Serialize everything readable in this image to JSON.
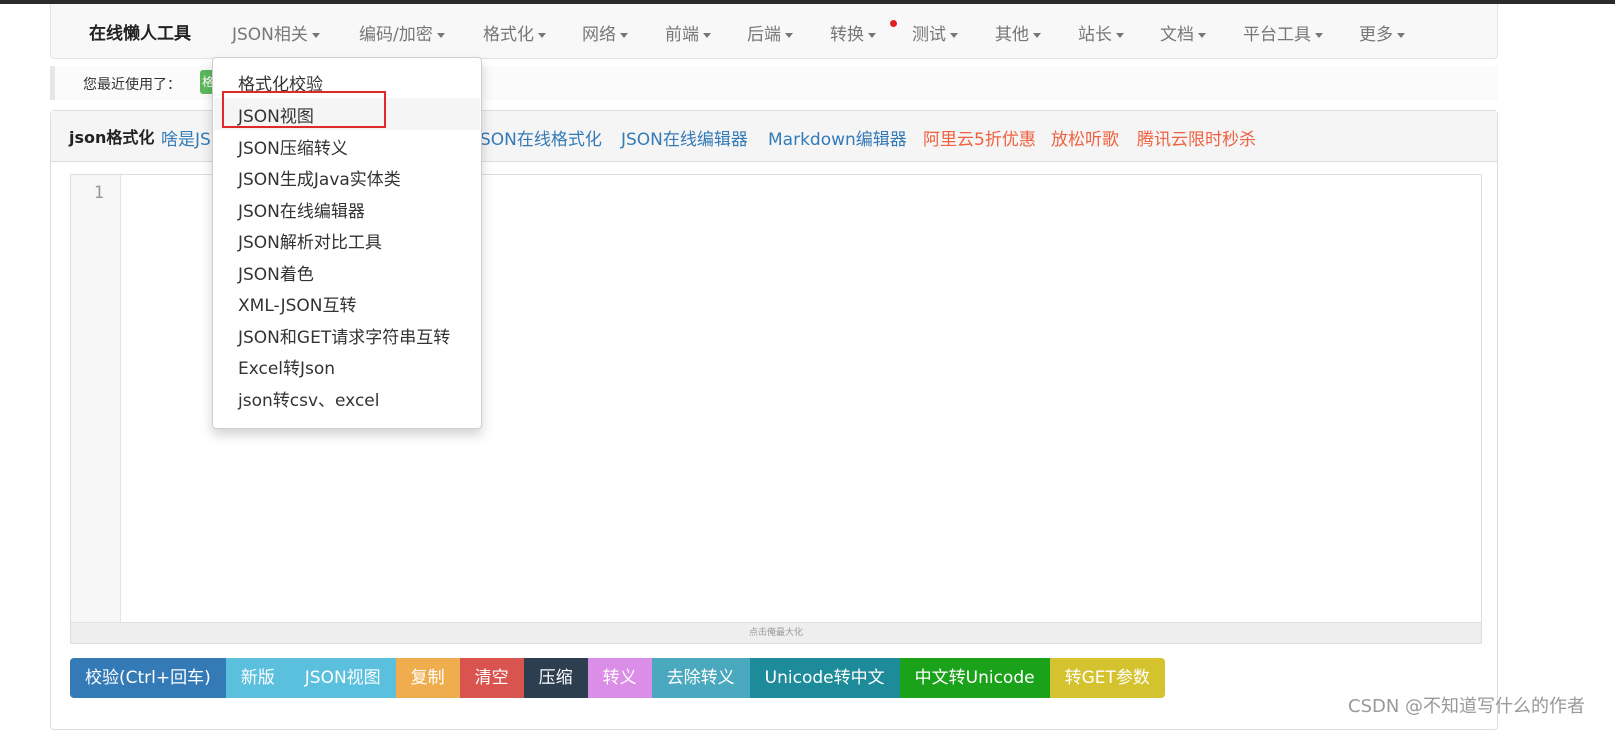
{
  "nav": {
    "brand": "在线懒人工具",
    "items": [
      {
        "label": "JSON相关"
      },
      {
        "label": "编码/加密"
      },
      {
        "label": "格式化"
      },
      {
        "label": "网络"
      },
      {
        "label": "前端"
      },
      {
        "label": "后端"
      },
      {
        "label": "转换"
      },
      {
        "label": "测试"
      },
      {
        "label": "其他"
      },
      {
        "label": "站长"
      },
      {
        "label": "文档"
      },
      {
        "label": "平台工具"
      },
      {
        "label": "更多"
      }
    ]
  },
  "recent": {
    "label": "您最近使用了：",
    "badge": "格"
  },
  "panel": {
    "title": "json格式化",
    "links": [
      {
        "label": "啥是JS",
        "color": "#337ab7"
      },
      {
        "label": "JSON在线格式化",
        "color": "#337ab7"
      },
      {
        "label": "JSON在线编辑器",
        "color": "#337ab7"
      },
      {
        "label": "Markdown编辑器",
        "color": "#337ab7"
      },
      {
        "label": "阿里云5折优惠",
        "color": "#f0613f"
      },
      {
        "label": "放松听歌",
        "color": "#f0613f"
      },
      {
        "label": "腾讯云限时秒杀",
        "color": "#f0613f"
      }
    ]
  },
  "editor": {
    "line_number": "1",
    "resize_hint": "点击俺最大化"
  },
  "buttons": [
    {
      "label": "校验(Ctrl+回车)",
      "color": "#337ab7"
    },
    {
      "label": "新版",
      "color": "#5bc0de"
    },
    {
      "label": "JSON视图",
      "color": "#5bc0de"
    },
    {
      "label": "复制",
      "color": "#f0ad4e"
    },
    {
      "label": "清空",
      "color": "#d9534f"
    },
    {
      "label": "压缩",
      "color": "#2c3e50"
    },
    {
      "label": "转义",
      "color": "#da8ee7"
    },
    {
      "label": "去除转义",
      "color": "#4aa9bf"
    },
    {
      "label": "Unicode转中文",
      "color": "#1e8b9a"
    },
    {
      "label": "中文转Unicode",
      "color": "#1aa21a"
    },
    {
      "label": "转GET参数",
      "color": "#d4c22f"
    }
  ],
  "dropdown": {
    "items": [
      "格式化校验",
      "JSON视图",
      "JSON压缩转义",
      "JSON生成Java实体类",
      "JSON在线编辑器",
      "JSON解析对比工具",
      "JSON着色",
      "XML-JSON互转",
      "JSON和GET请求字符串互转",
      "Excel转Json",
      "json转csv、excel"
    ],
    "highlighted": "JSON视图"
  },
  "watermark": "CSDN @不知道写什么的作者"
}
